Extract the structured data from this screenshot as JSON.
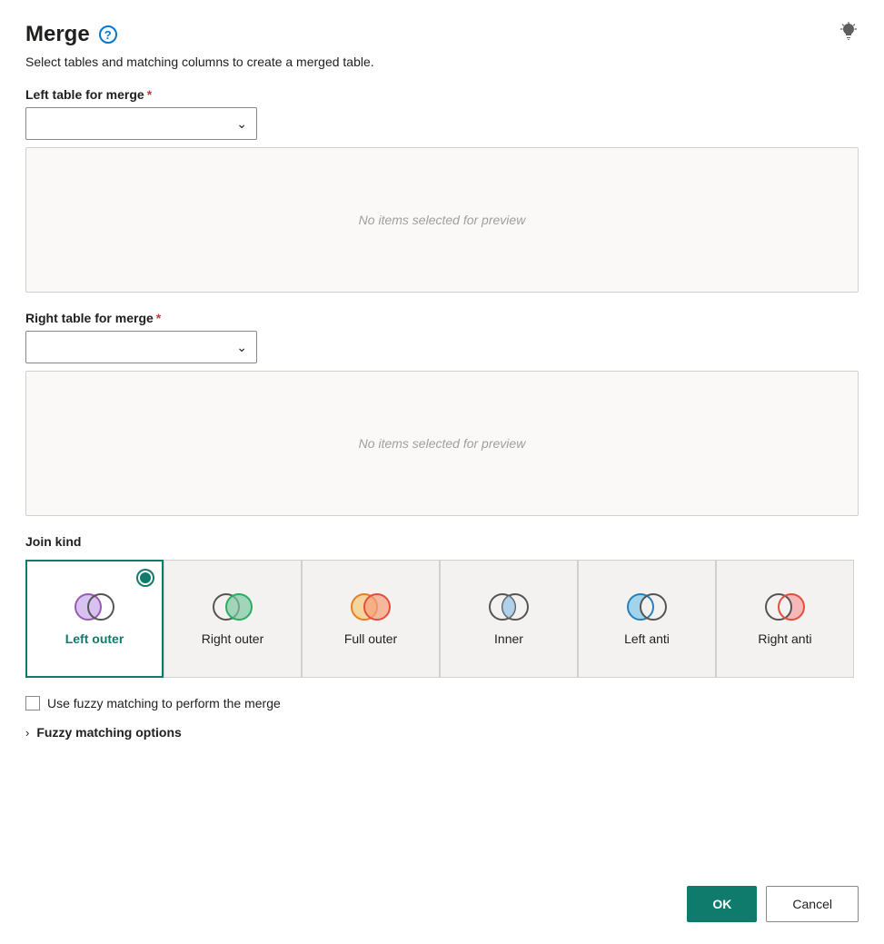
{
  "dialog": {
    "title": "Merge",
    "subtitle": "Select tables and matching columns to create a merged table.",
    "help_icon_label": "?",
    "bulb_icon": "💡"
  },
  "left_table": {
    "label": "Left table for merge",
    "required": true,
    "placeholder": "",
    "preview_text": "No items selected for preview"
  },
  "right_table": {
    "label": "Right table for merge",
    "required": true,
    "placeholder": "",
    "preview_text": "No items selected for preview"
  },
  "join_kind": {
    "label": "Join kind",
    "options": [
      {
        "id": "left-outer",
        "label": "Left outer",
        "selected": true
      },
      {
        "id": "right-outer",
        "label": "Right outer",
        "selected": false
      },
      {
        "id": "full-outer",
        "label": "Full outer",
        "selected": false
      },
      {
        "id": "inner",
        "label": "Inner",
        "selected": false
      },
      {
        "id": "left-anti",
        "label": "Left anti",
        "selected": false
      },
      {
        "id": "right-anti",
        "label": "Right anti",
        "selected": false
      }
    ]
  },
  "fuzzy_matching": {
    "checkbox_label": "Use fuzzy matching to perform the merge",
    "options_label": "Fuzzy matching options",
    "checked": false
  },
  "footer": {
    "ok_label": "OK",
    "cancel_label": "Cancel"
  }
}
